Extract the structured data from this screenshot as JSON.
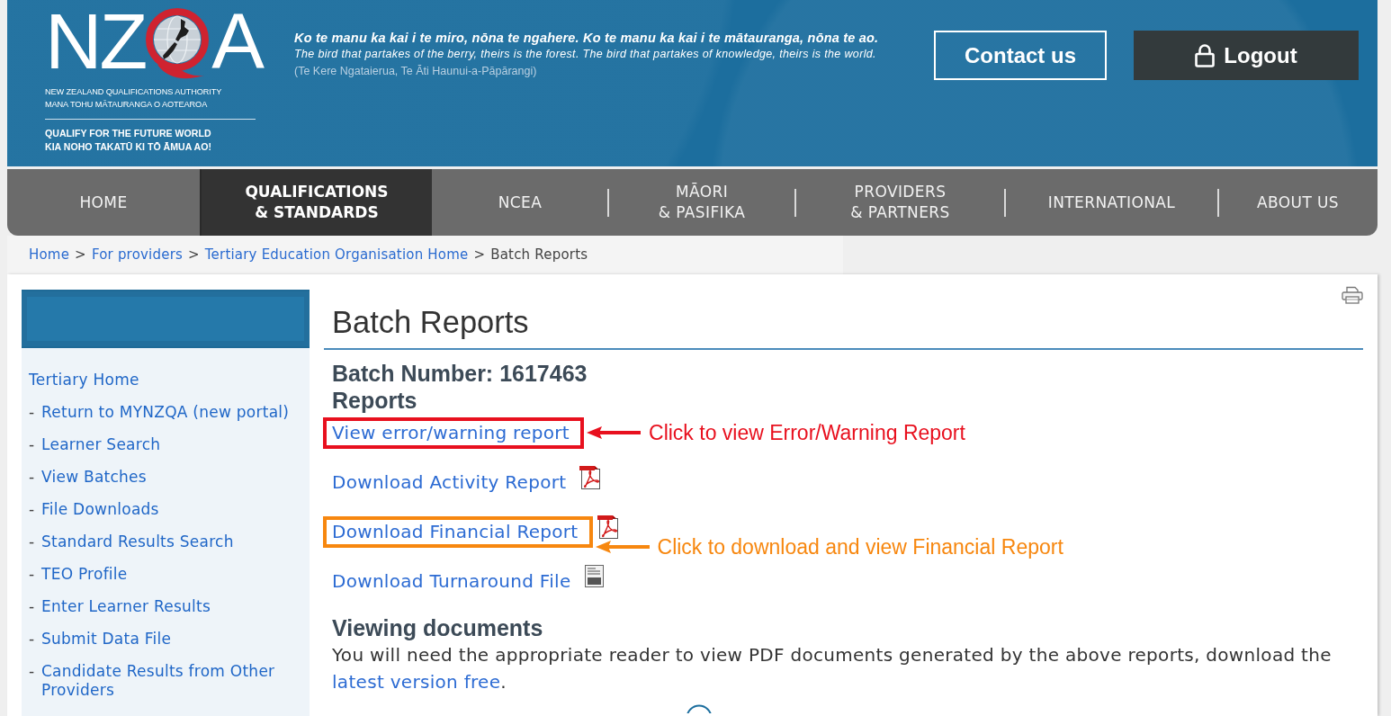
{
  "header": {
    "logo": {
      "letters_start": "NZ",
      "letters_end": "A",
      "name_lines": [
        "NEW ZEALAND QUALIFICATIONS AUTHORITY",
        "MANA TOHU MĀTAURANGA O AOTEAROA"
      ],
      "slogan_lines": [
        "QUALIFY FOR THE FUTURE WORLD",
        "KIA NOHO TAKATŪ KI TŌ ĀMUA AO!"
      ]
    },
    "proverb": {
      "maori": "Ko te manu ka kai i te miro, nōna te ngahere. Ko te manu ka kai i te mātauranga, nōna te ao.",
      "english": "The bird that partakes of the berry, theirs is the forest. The bird that partakes of knowledge, theirs is the world.",
      "attribution": "(Te Kere Ngataierua, Te Āti Haunui-a-Pāpārangi)"
    },
    "buttons": [
      {
        "label": "Contact us",
        "kind": "outline"
      },
      {
        "label": "Logout",
        "kind": "logout"
      }
    ]
  },
  "nav": [
    {
      "lines": [
        "HOME"
      ],
      "selected": false
    },
    {
      "lines": [
        "QUALIFICATIONS",
        "& STANDARDS"
      ],
      "selected": true
    },
    {
      "lines": [
        "NCEA"
      ],
      "selected": false
    },
    {
      "lines": [
        "MĀORI",
        "& PASIFIKA"
      ],
      "selected": false
    },
    {
      "lines": [
        "PROVIDERS",
        "& PARTNERS"
      ],
      "selected": false
    },
    {
      "lines": [
        "INTERNATIONAL"
      ],
      "selected": false
    },
    {
      "lines": [
        "ABOUT US"
      ],
      "selected": false
    }
  ],
  "breadcrumb": [
    {
      "kind": "link",
      "label": "Home"
    },
    {
      "kind": "separator",
      "label": ">"
    },
    {
      "kind": "link",
      "label": "For providers"
    },
    {
      "kind": "separator",
      "label": ">"
    },
    {
      "kind": "link",
      "label": "Tertiary Education Organisation Home"
    },
    {
      "kind": "separator",
      "label": ">"
    },
    {
      "kind": "current",
      "label": "Batch Reports"
    }
  ],
  "sidebar": {
    "items": [
      {
        "label": "Tertiary Home"
      },
      {
        "bullet": "-",
        "label": "Return to MYNZQA (new portal)"
      },
      {
        "bullet": "-",
        "label": "Learner Search"
      },
      {
        "bullet": "-",
        "label": "View Batches"
      },
      {
        "bullet": "-",
        "label": "File Downloads"
      },
      {
        "bullet": "-",
        "label": "Standard Results Search"
      },
      {
        "bullet": "-",
        "label": "TEO Profile"
      },
      {
        "bullet": "-",
        "label": "Enter Learner Results"
      },
      {
        "bullet": "-",
        "label": "Submit Data File"
      },
      {
        "bullet": "-",
        "label": "Candidate Results from Other Providers"
      }
    ]
  },
  "content": {
    "title": "Batch Reports",
    "batch_number": "Batch Number: 1617463",
    "reports_heading": "Reports",
    "links": [
      {
        "label": "View error/warning report",
        "kind": "plain",
        "annotation": {
          "color": "#e8101e",
          "text": "Click to view Error/Warning Report"
        }
      },
      {
        "label": "Download Activity Report",
        "kind": "pdf"
      },
      {
        "label": "Download Financial Report",
        "kind": "pdf",
        "annotation": {
          "color": "#f7870f",
          "text": "Click to download and view Financial Report"
        }
      },
      {
        "label": "Download Turnaround File",
        "kind": "file"
      }
    ],
    "viewing": {
      "heading": "Viewing documents",
      "text": "You will need the appropriate reader to view PDF documents generated by the above reports, download the ",
      "link": "latest version free",
      "after": "."
    }
  }
}
